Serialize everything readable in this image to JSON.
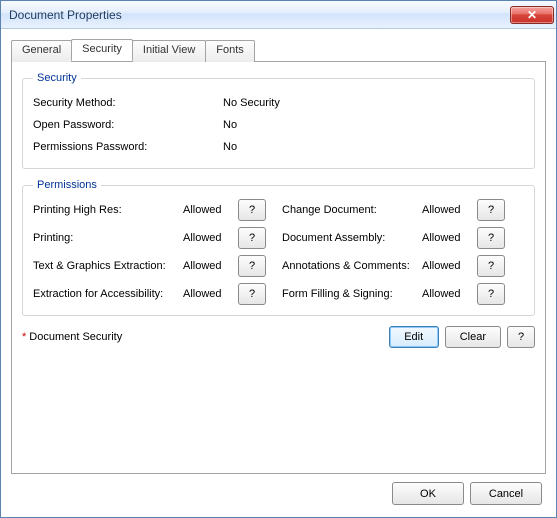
{
  "window": {
    "title": "Document Properties",
    "close_glyph": "✕"
  },
  "tabs": {
    "general": "General",
    "security": "Security",
    "initial_view": "Initial View",
    "fonts": "Fonts"
  },
  "security_group": {
    "legend": "Security",
    "method_label": "Security Method:",
    "method_value": "No Security",
    "open_pw_label": "Open Password:",
    "open_pw_value": "No",
    "perm_pw_label": "Permissions Password:",
    "perm_pw_value": "No"
  },
  "permissions_group": {
    "legend": "Permissions",
    "q": "?",
    "rows_left": [
      {
        "label": "Printing High Res:",
        "value": "Allowed"
      },
      {
        "label": "Printing:",
        "value": "Allowed"
      },
      {
        "label": "Text & Graphics Extraction:",
        "value": "Allowed"
      },
      {
        "label": "Extraction for Accessibility:",
        "value": "Allowed"
      }
    ],
    "rows_right": [
      {
        "label": "Change Document:",
        "value": "Allowed"
      },
      {
        "label": "Document Assembly:",
        "value": "Allowed"
      },
      {
        "label": "Annotations & Comments:",
        "value": "Allowed"
      },
      {
        "label": "Form Filling & Signing:",
        "value": "Allowed"
      }
    ]
  },
  "footer": {
    "star": "*",
    "label": "Document Security",
    "edit": "Edit",
    "clear": "Clear",
    "help": "?"
  },
  "dialog_buttons": {
    "ok": "OK",
    "cancel": "Cancel"
  }
}
